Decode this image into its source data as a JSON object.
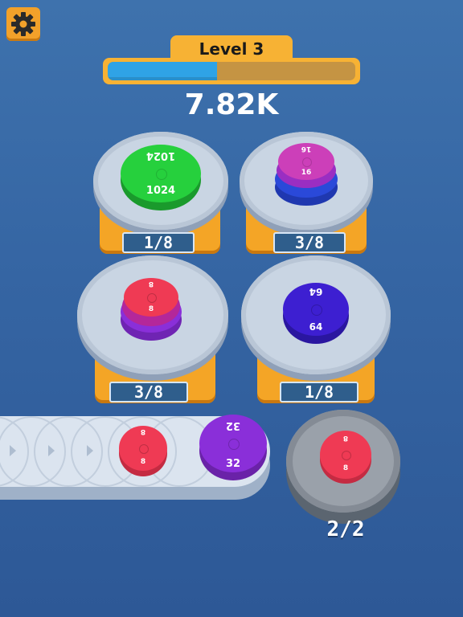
{
  "header": {
    "level_label": "Level 3",
    "level_progress": 0.44,
    "score": "7.82K"
  },
  "colors": {
    "green": "#22c93a",
    "pink": "#cc3fb9",
    "blue": "#2a49d9",
    "red": "#ef3a54",
    "purple": "#8a2fd9",
    "navy": "#3d1fd1",
    "accent": "#f4a526"
  },
  "stacks": [
    {
      "counter": "1/8",
      "top_value": "1024",
      "top_value_flipped": "1024"
    },
    {
      "counter": "3/8",
      "top_value": "16",
      "top_value_flipped": "16"
    },
    {
      "counter": "3/8",
      "top_value": "8",
      "top_value_flipped": "8"
    },
    {
      "counter": "1/8",
      "top_value": "64",
      "top_value_flipped": "64"
    }
  ],
  "conveyor": {
    "coins": [
      {
        "value": "8",
        "value_flipped": "8",
        "color": "red"
      },
      {
        "value": "32",
        "value_flipped": "32",
        "color": "purple"
      }
    ]
  },
  "holder": {
    "counter": "2/2",
    "coin_value": "8",
    "coin_value_flipped": "8"
  }
}
